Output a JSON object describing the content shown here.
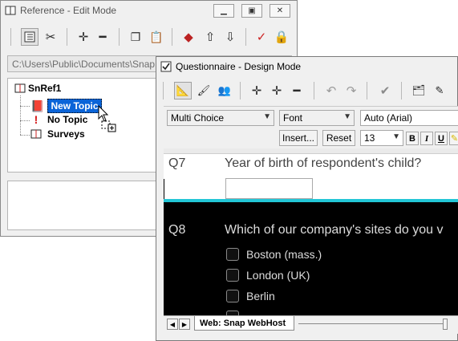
{
  "ref_window": {
    "title": "Reference - Edit Mode",
    "path": "C:\\Users\\Public\\Documents\\Snap",
    "tree": {
      "root": "SnRef1",
      "items": [
        "New Topic",
        "No Topic",
        "Surveys"
      ]
    },
    "toolbar_icons": [
      "details-view-icon",
      "tools-icon",
      "plus-icon",
      "minus-icon",
      "copy-icon",
      "paste-icon",
      "tag-icon",
      "up-arrow-icon",
      "down-arrow-icon",
      "check-mark-icon",
      "lock-icon"
    ]
  },
  "design_window": {
    "title": "Questionnaire - Design Mode",
    "question_type": "Multi Choice",
    "font_setting": "Font",
    "font_name": "Auto (Arial)",
    "font_size": "13",
    "insert_label": "Insert...",
    "reset_label": "Reset",
    "bold_label": "B",
    "italic_label": "I",
    "underline_label": "U",
    "questions": [
      {
        "number": "Q7",
        "text": "Year of birth of respondent's child?"
      },
      {
        "number": "Q8",
        "text": "Which of our company's sites do you v"
      }
    ],
    "q8_options": [
      "Boston (mass.)",
      "London (UK)",
      "Berlin"
    ],
    "tab_label": "Web: Snap WebHost"
  },
  "colors": {
    "selection": "#0a64d8",
    "dark_panel": "#000000",
    "cyan_divider": "#23c6d6",
    "option_text": "#dcdcdc"
  }
}
